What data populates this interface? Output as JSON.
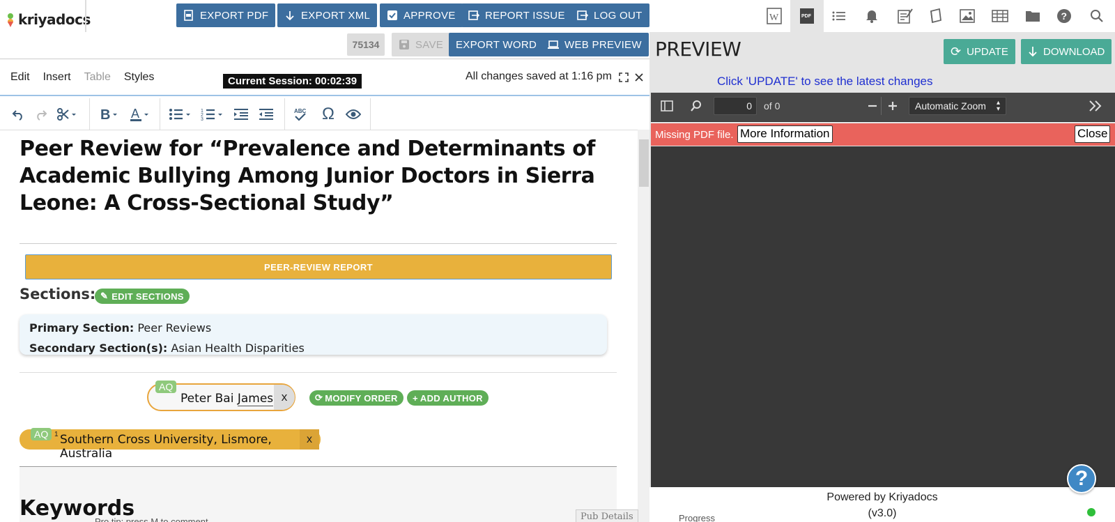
{
  "app": {
    "name": "kriyadocs"
  },
  "toolbar_top": {
    "export_pdf": "EXPORT PDF",
    "export_xml": "EXPORT XML",
    "approve": "APPROVE",
    "report_issue": "REPORT ISSUE",
    "log_out": "LOG OUT",
    "doc_id": "75134",
    "save": "SAVE",
    "export_word": "EXPORT WORD",
    "web_preview": "WEB PREVIEW"
  },
  "menu": [
    "Edit",
    "Insert",
    "Table",
    "Styles"
  ],
  "session": "Current Session: 00:02:39",
  "saved_status": "All changes saved at 1:16 pm",
  "document": {
    "title": "Peer Review for “Prevalence and Determinants of Academic Bullying Among Junior Doctors in Sierra Leone: A Cross-Sectional Study”",
    "banner": "PEER-REVIEW REPORT",
    "sections_label": "Sections:",
    "edit_sections": "EDIT SECTIONS",
    "primary_label": "Primary Section:",
    "primary_value": "Peer Reviews",
    "secondary_label": "Secondary Section(s):",
    "secondary_value": "Asian Health Disparities",
    "author_tag": "AQ",
    "author_first": "Peter Bai ",
    "author_last": "James",
    "author_sup": "1",
    "remove": "x",
    "modify_order": "MODIFY ORDER",
    "add_author": "ADD AUTHOR",
    "affil_sup": "1",
    "affiliation": "Southern Cross University, Lismore, Australia",
    "keywords": "Keywords",
    "pub_details": "Pub Details",
    "ghost_text": "Pro tip: press  M  to comment"
  },
  "preview": {
    "title": "PREVIEW",
    "update": "UPDATE",
    "download": "DOWNLOAD",
    "hint": "Click 'UPDATE' to see the latest changes",
    "page_value": "0",
    "page_of": "of 0",
    "zoom": "Automatic Zoom",
    "error": "Missing PDF file.",
    "more_info": "More Information",
    "close": "Close",
    "powered": "Powered by Kriyadocs",
    "version": "(v3.0)",
    "ghost_text": "Progress"
  },
  "colors": {
    "toolbar_blue": "#3c6e9f",
    "accent_green": "#4aaa96",
    "pill_green": "#5fae57",
    "banner_orange": "#e8b13c",
    "error_red": "#e9635c"
  }
}
